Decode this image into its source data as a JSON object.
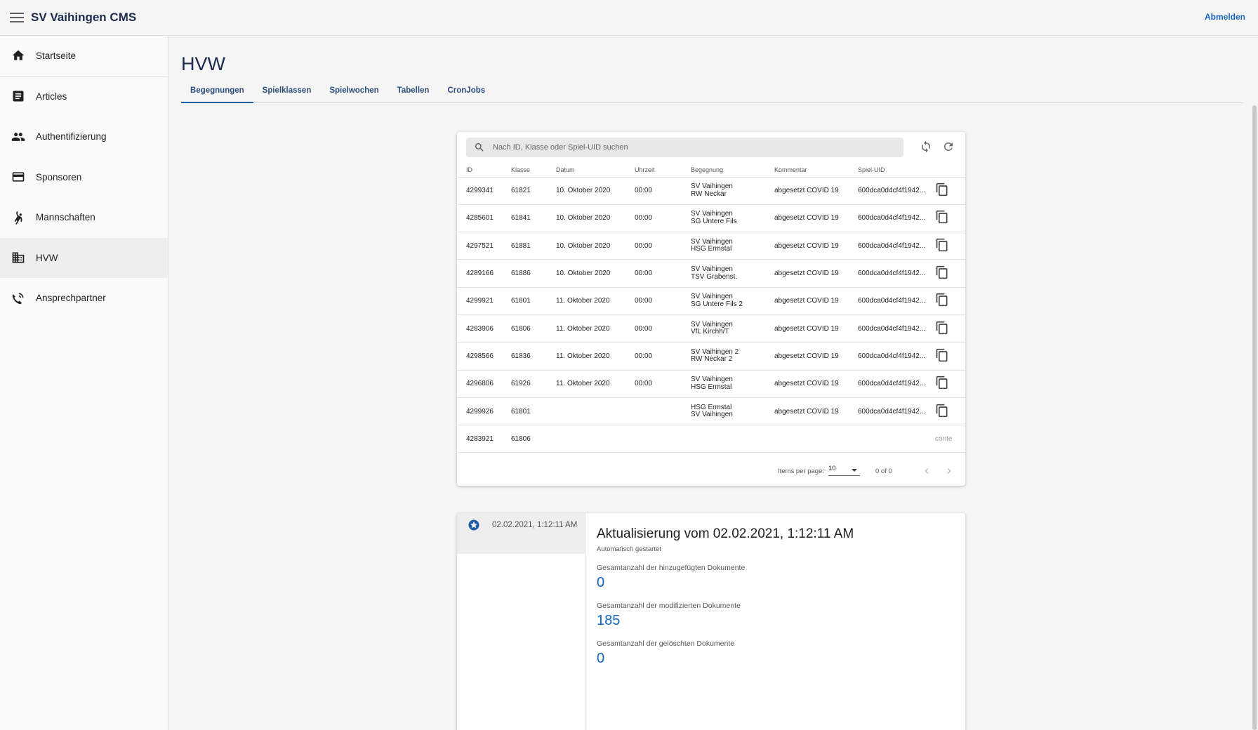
{
  "app": {
    "title": "SV Vaihingen CMS",
    "logout_label": "Abmelden"
  },
  "sidebar": {
    "items": [
      {
        "label": "Startseite",
        "icon": "home-icon"
      },
      {
        "label": "Articles",
        "icon": "article-icon"
      },
      {
        "label": "Authentifizierung",
        "icon": "people-icon"
      },
      {
        "label": "Sponsoren",
        "icon": "credit-card-icon"
      },
      {
        "label": "Mannschaften",
        "icon": "sports-handball-icon"
      },
      {
        "label": "HVW",
        "icon": "domain-icon"
      },
      {
        "label": "Ansprechpartner",
        "icon": "contact-phone-icon"
      }
    ],
    "active": "HVW"
  },
  "page": {
    "title": "HVW",
    "tabs": [
      "Begegnungen",
      "Spielklassen",
      "Spielwochen",
      "Tabellen",
      "CronJobs"
    ],
    "active_tab": "Begegnungen"
  },
  "search": {
    "placeholder": "Nach ID, Klasse oder Spiel-UID suchen"
  },
  "table": {
    "headers": [
      "ID",
      "Klasse",
      "Datum",
      "Uhrzeit",
      "Begegnung",
      "Kommentar",
      "Spiel-UID"
    ],
    "rows": [
      {
        "id": "4299341",
        "klasse": "61821",
        "datum": "10. Oktober 2020",
        "uhrzeit": "00:00",
        "home": "SV Vaihingen",
        "away": "RW Neckar",
        "kommentar": "abgesetzt COVID 19",
        "uid": "600dca0d4cf4f1942..."
      },
      {
        "id": "4285601",
        "klasse": "61841",
        "datum": "10. Oktober 2020",
        "uhrzeit": "00:00",
        "home": "SV Vaihingen",
        "away": "SG Untere Fils",
        "kommentar": "abgesetzt COVID 19",
        "uid": "600dca0d4cf4f1942..."
      },
      {
        "id": "4297521",
        "klasse": "61881",
        "datum": "10. Oktober 2020",
        "uhrzeit": "00:00",
        "home": "SV Vaihingen",
        "away": "HSG Ermstal",
        "kommentar": "abgesetzt COVID 19",
        "uid": "600dca0d4cf4f1942..."
      },
      {
        "id": "4289166",
        "klasse": "61886",
        "datum": "10. Oktober 2020",
        "uhrzeit": "00:00",
        "home": "SV Vaihingen",
        "away": "TSV Grabenst.",
        "kommentar": "abgesetzt COVID 19",
        "uid": "600dca0d4cf4f1942..."
      },
      {
        "id": "4299921",
        "klasse": "61801",
        "datum": "11. Oktober 2020",
        "uhrzeit": "00:00",
        "home": "SV Vaihingen",
        "away": "SG Untere Fils 2",
        "kommentar": "abgesetzt COVID 19",
        "uid": "600dca0d4cf4f1942..."
      },
      {
        "id": "4283906",
        "klasse": "61806",
        "datum": "11. Oktober 2020",
        "uhrzeit": "00:00",
        "home": "SV Vaihingen",
        "away": "VfL Kirchh/T",
        "kommentar": "abgesetzt COVID 19",
        "uid": "600dca0d4cf4f1942..."
      },
      {
        "id": "4298566",
        "klasse": "61836",
        "datum": "11. Oktober 2020",
        "uhrzeit": "00:00",
        "home": "SV Vaihingen 2",
        "away": "RW Neckar 2",
        "kommentar": "abgesetzt COVID 19",
        "uid": "600dca0d4cf4f1942..."
      },
      {
        "id": "4296806",
        "klasse": "61926",
        "datum": "11. Oktober 2020",
        "uhrzeit": "00:00",
        "home": "SV Vaihingen",
        "away": "HSG Ermstal",
        "kommentar": "abgesetzt COVID 19",
        "uid": "600dca0d4cf4f1942..."
      },
      {
        "id": "4299926",
        "klasse": "61801",
        "datum": "",
        "uhrzeit": "",
        "home": "HSG Ermstal",
        "away": "SV Vaihingen",
        "kommentar": "abgesetzt COVID 19",
        "uid": "600dca0d4cf4f1942..."
      },
      {
        "id": "4283921",
        "klasse": "61806",
        "datum": "",
        "uhrzeit": "",
        "home": "",
        "away": "",
        "kommentar": "",
        "uid": "",
        "trailing": "conte"
      }
    ]
  },
  "paginator": {
    "label": "Items per page:",
    "page_size": "10",
    "range": "0 of 0"
  },
  "cron": {
    "item_timestamp": "02.02.2021, 1:12:11 AM",
    "title": "Aktualisierung vom 02.02.2021, 1:12:11 AM",
    "subtitle": "Automatisch gestartet",
    "stats": [
      {
        "label": "Gesamtanzahl der hinzugefügten Dokumente",
        "value": "0"
      },
      {
        "label": "Gesamtanzahl der modifizierten Dokumente",
        "value": "185"
      },
      {
        "label": "Gesamtanzahl der gelöschten Dokumente",
        "value": "0"
      }
    ]
  }
}
